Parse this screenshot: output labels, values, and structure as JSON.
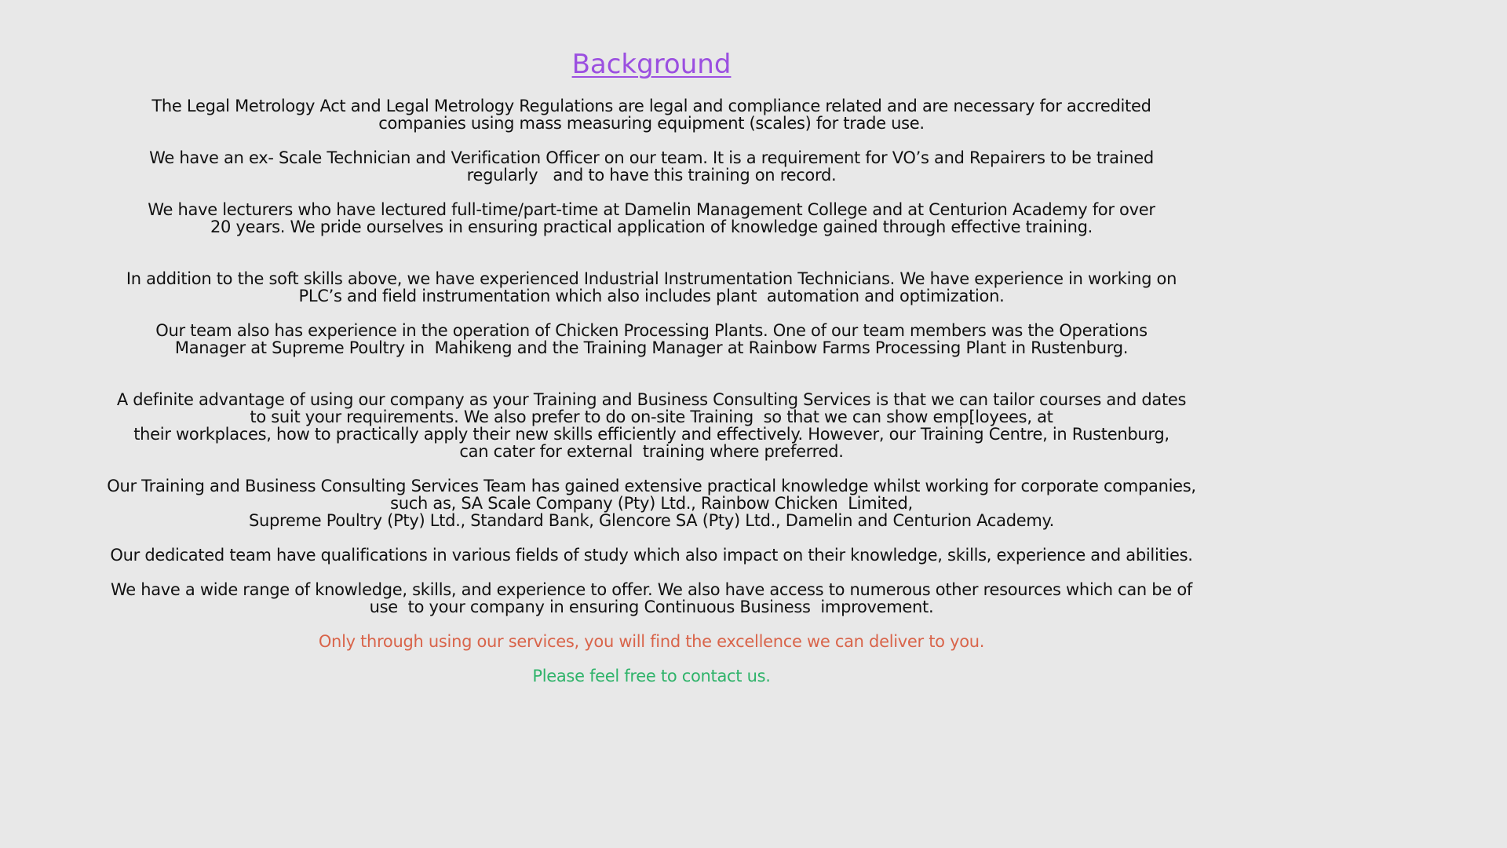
{
  "heading": "Background",
  "paragraphs": [
    {
      "lines": [
        "The Legal Metrology Act and Legal Metrology Regulations are legal and compliance related and are necessary for accredited",
        "companies using mass measuring equipment (scales) for trade use."
      ]
    },
    {
      "lines": [
        "We have an ex- Scale Technician and Verification Officer on our team. It is a requirement for VO’s and Repairers to be trained",
        "regularly   and to have this training on record."
      ]
    },
    {
      "lines": [
        "We have lecturers who have lectured full-time/part-time at Damelin Management College and at Centurion Academy for over",
        "20 years. We pride ourselves in ensuring practical application of knowledge gained through effective training."
      ]
    },
    {
      "lines": [
        "In addition to the soft skills above, we have experienced Industrial Instrumentation Technicians. We have experience in working on",
        "PLC’s and field instrumentation which also includes plant  automation and optimization."
      ]
    },
    {
      "lines": [
        "Our team also has experience in the operation of Chicken Processing Plants. One of our team members was the Operations",
        "Manager at Supreme Poultry in  Mahikeng and the Training Manager at Rainbow Farms Processing Plant in Rustenburg."
      ]
    },
    {
      "lines": [
        "A definite advantage of using our company as your Training and Business Consulting Services is that we can tailor courses and dates",
        "to suit your requirements. We also prefer to do on-site Training  so that we can show emp[loyees, at",
        "their workplaces, how to practically apply their new skills efficiently and effectively. However, our Training Centre, in Rustenburg,",
        "can cater for external  training where preferred."
      ]
    },
    {
      "lines": [
        "Our Training and Business Consulting Services Team has gained extensive practical knowledge whilst working for corporate companies,",
        "such as, SA Scale Company (Pty) Ltd., Rainbow Chicken  Limited,",
        "Supreme Poultry (Pty) Ltd., Standard Bank, Glencore SA (Pty) Ltd., Damelin and Centurion Academy."
      ]
    },
    {
      "lines": [
        "Our dedicated team have qualifications in various fields of study which also impact on their knowledge, skills, experience and abilities."
      ]
    },
    {
      "lines": [
        "We have a wide range of knowledge, skills, and experience to offer. We also have access to numerous other resources which can be of",
        "use  to your company in ensuring Continuous Business  improvement."
      ]
    }
  ],
  "closing": "Only through using our services, you will find the excellence we can deliver to you.",
  "contact": "Please feel free to contact us.",
  "colors": {
    "background": "#e8e8e8",
    "heading": "#9b4fe0",
    "body_text": "#111111",
    "closing": "#d9644a",
    "contact": "#2fb36a"
  }
}
